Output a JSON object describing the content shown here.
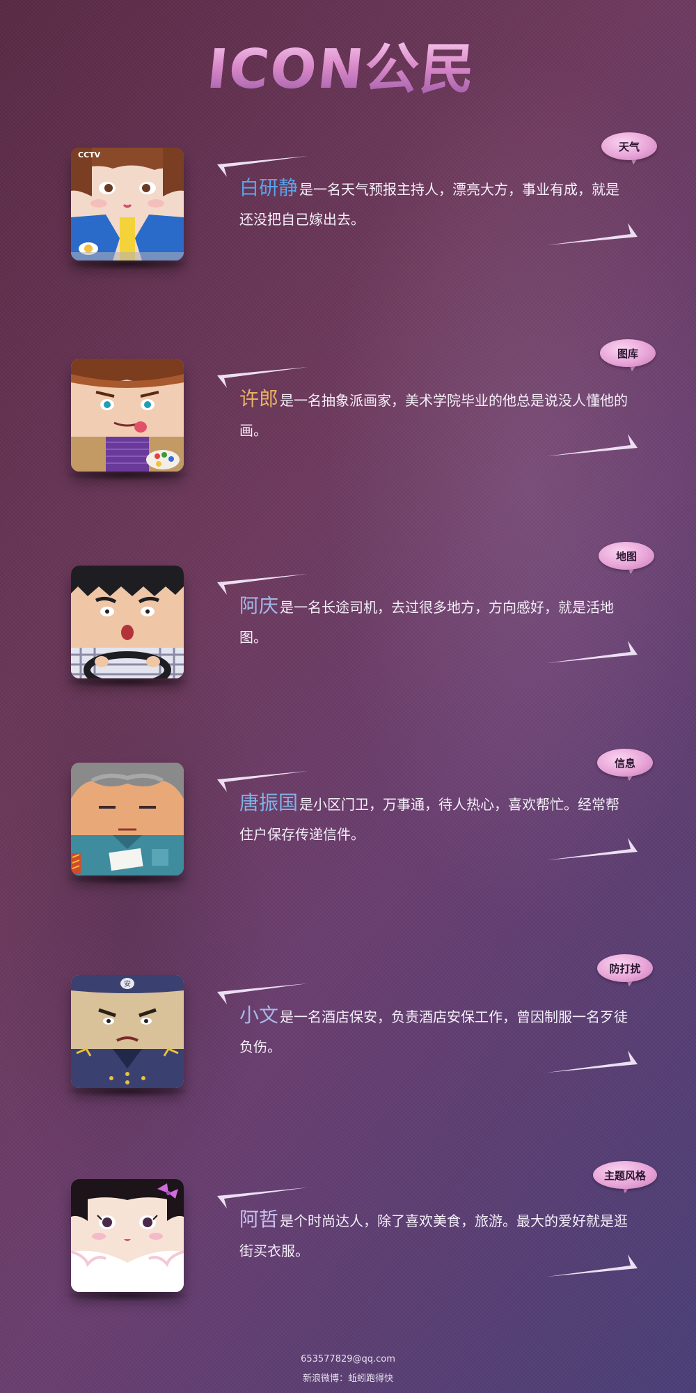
{
  "header": {
    "logo_text": "ICON公民"
  },
  "items": [
    {
      "name": "白研静",
      "text": "是一名天气预报主持人，漂亮大方，事业有成，就是还没把自己嫁出去。",
      "bubble": "天气",
      "name_color": "#5aa2e8",
      "icon": "weather-host-icon",
      "badge": "CCTV"
    },
    {
      "name": "许郎",
      "text": "是一名抽象派画家，美术学院毕业的他总是说没人懂他的画。",
      "bubble": "图库",
      "name_color": "#e8b063",
      "icon": "painter-icon"
    },
    {
      "name": "阿庆",
      "text": "是一名长途司机，去过很多地方，方向感好，就是活地图。",
      "bubble": "地图",
      "name_color": "#a3b6e8",
      "icon": "driver-icon"
    },
    {
      "name": "唐振国",
      "text": "是小区门卫，万事通，待人热心，喜欢帮忙。经常帮住户保存传递信件。",
      "bubble": "信息",
      "name_color": "#7fb2e6",
      "icon": "doorman-icon"
    },
    {
      "name": "小文",
      "text": "是一名酒店保安，负责酒店安保工作，曾因制服一名歹徒负伤。",
      "bubble": "防打扰",
      "name_color": "#a8b8e8",
      "icon": "security-guard-icon",
      "badge": "安"
    },
    {
      "name": "阿哲",
      "text": "是个时尚达人，除了喜欢美食，旅游。最大的爱好就是逛街买衣服。",
      "bubble": "主题风格",
      "name_color": "#c9c2ee",
      "icon": "fashion-girl-icon"
    }
  ],
  "footer": {
    "email": "653577829@qq.com",
    "weibo": "新浪微博：蚯蚓跑得快"
  }
}
